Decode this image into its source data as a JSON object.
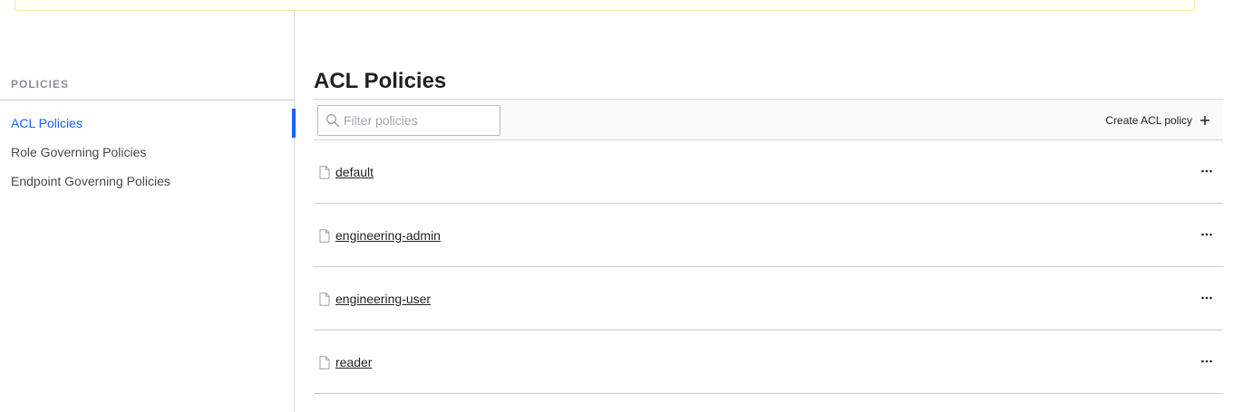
{
  "sidebar": {
    "heading": "POLICIES",
    "items": [
      {
        "label": "ACL Policies",
        "active": true
      },
      {
        "label": "Role Governing Policies",
        "active": false
      },
      {
        "label": "Endpoint Governing Policies",
        "active": false
      }
    ]
  },
  "main": {
    "title": "ACL Policies",
    "search": {
      "placeholder": "Filter policies",
      "value": ""
    },
    "create_label": "Create ACL policy",
    "policies": [
      {
        "name": "default"
      },
      {
        "name": "engineering-admin"
      },
      {
        "name": "engineering-user"
      },
      {
        "name": "reader"
      }
    ]
  },
  "icons": {
    "search": "search-icon",
    "create": "plus-icon",
    "file": "file-icon",
    "more": "more-horizontal-icon"
  },
  "colors": {
    "accent": "#1563ff",
    "text": "#1f2124",
    "muted": "#8b8f97",
    "border": "#d5d7dc"
  }
}
